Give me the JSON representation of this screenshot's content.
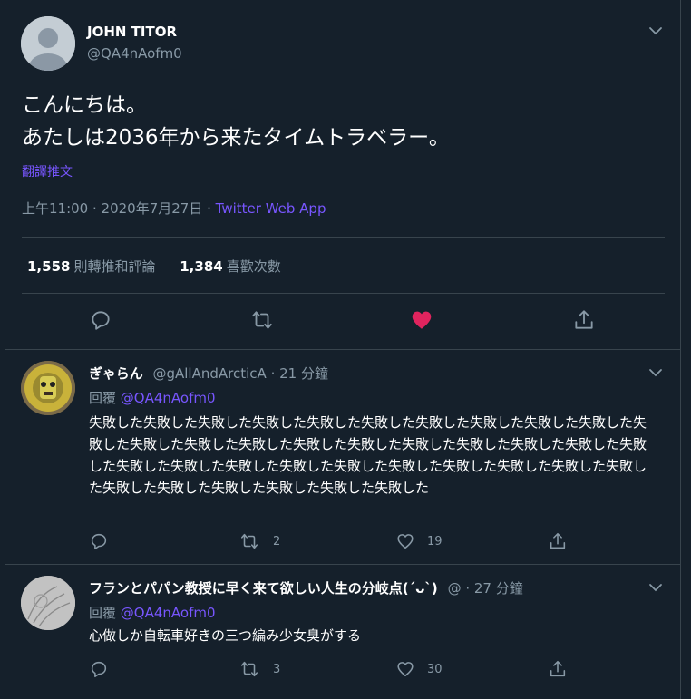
{
  "tweet": {
    "name": "JOHN TITOR",
    "handle": "@QA4nAofm0",
    "text": "こんにちは。\nあたしは2036年から来たタイムトラベラー。",
    "translate": "翻譯推文",
    "time": "上午11:00 · 2020年7月27日 · ",
    "source": "Twitter Web App",
    "retweets_count": "1,558",
    "retweets_label": "則轉推和評論",
    "likes_count": "1,384",
    "likes_label": "喜歡次數",
    "colors": {
      "like": "#e0245e",
      "link": "#7856ff",
      "muted": "#8899a6",
      "bg": "#15202b"
    }
  },
  "replies": [
    {
      "name": "ぎゃらん",
      "handle": "@gAllAndArcticA",
      "time": " · 21 分鐘",
      "reply_prefix": "回覆 ",
      "reply_to": "@QA4nAofm0",
      "text": "失敗した失敗した失敗した失敗した失敗した失敗した失敗した失敗した失敗した失敗した失敗した失敗した失敗した失敗した失敗した失敗した失敗した失敗した失敗した失敗した失敗した失敗した失敗した失敗した失敗した失敗した失敗した失敗した失敗した失敗した失敗した失敗した失敗した失敗した失敗した失敗した失敗した",
      "retweets": "2",
      "likes": "19"
    },
    {
      "name": "フランとパパン教授に早く来て欲しい人生の分岐点(´ᴗ`)",
      "handle": "@",
      "time": " · 27 分鐘",
      "reply_prefix": "回覆 ",
      "reply_to": "@QA4nAofm0",
      "text": "心做しか自転車好きの三つ編み少女臭がする",
      "retweets": "3",
      "likes": "30"
    }
  ]
}
